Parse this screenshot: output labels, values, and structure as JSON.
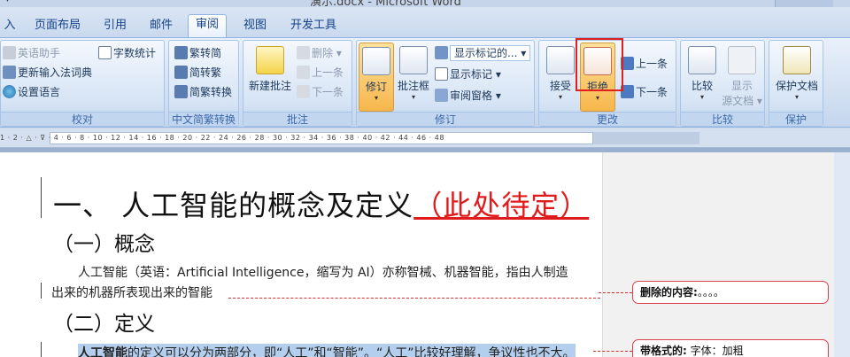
{
  "window": {
    "title": "演示.docx - Microsoft Word"
  },
  "tabs": [
    "入",
    "页面布局",
    "引用",
    "邮件",
    "审阅",
    "视图",
    "开发工具"
  ],
  "ribbon": {
    "proofing": {
      "label": "校对",
      "items": [
        "英语助手",
        "更新输入法词典",
        "设置语言"
      ],
      "word_count": "字数统计"
    },
    "chinese_conversion": {
      "label": "中文简繁转换",
      "items": [
        "繁转简",
        "简转繁",
        "简繁转换"
      ]
    },
    "comments": {
      "label": "批注",
      "new_comment": "新建批注",
      "delete": "删除",
      "prev": "上一条",
      "next": "下一条"
    },
    "tracking": {
      "label": "修订",
      "track_changes": "修订",
      "balloons": "批注框",
      "display_mode": "显示标记的...",
      "show_markup": "显示标记",
      "reviewing_pane": "审阅窗格"
    },
    "changes": {
      "label": "更改",
      "accept": "接受",
      "reject": "拒绝",
      "prev": "上一条",
      "next": "下一条"
    },
    "compare": {
      "label": "比较",
      "compare": "比较",
      "show_source": "显示",
      "show_source2": "源文档"
    },
    "protect": {
      "label": "保护",
      "protect_doc": "保护文档"
    }
  },
  "ruler": {
    "numbers": "1 · 2 · △ · ⊽ · 4 · 6 · 8 · 10 · 12 · 14 · 16 · 18 · 20 · 22 · 24 · 26 · 28 · 30 · 32 · 34 · 36 · 38 · 40 · 42 · 44 · 46 · 48"
  },
  "document": {
    "heading1": "一、  人工智能的概念及定义",
    "heading1_insert": "（此处待定）",
    "heading2_a": "（一）概念",
    "para1_line1": "人工智能（英语：Artificial Intelligence，缩写为 AI）亦称智械、机器智能，指由人制造",
    "para1_line2": "出来的机器所表现出来的智能",
    "heading2_b": "（二）定义",
    "para2_bold": "人工智能",
    "para2_rest": "的定义可以分为两部分，即“人工”和“智能”。“人工”比较好理解，争议性也不大。"
  },
  "balloons": [
    {
      "label": "删除的内容:",
      "text": "。。。。"
    },
    {
      "label": "带格式的:",
      "text": "字体：加粗"
    }
  ],
  "colors": {
    "insert": "#e01b1b",
    "highlight_box": "#e0201c",
    "balloon_border": "#d8404b"
  }
}
